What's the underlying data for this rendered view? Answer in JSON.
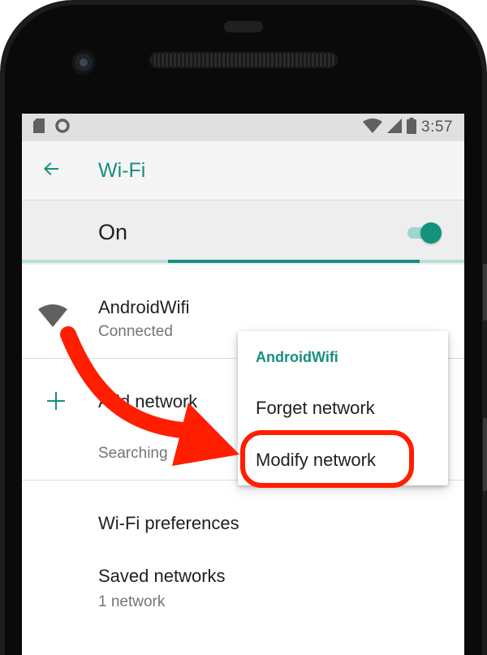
{
  "status_bar": {
    "time": "3:57"
  },
  "toolbar": {
    "title": "Wi-Fi"
  },
  "master_switch": {
    "label": "On",
    "checked": true
  },
  "networks": [
    {
      "ssid": "AndroidWifi",
      "status": "Connected"
    }
  ],
  "add_network": {
    "label": "Add network",
    "sub": "Searching"
  },
  "preferences": [
    {
      "title": "Wi-Fi preferences",
      "sub": ""
    },
    {
      "title": "Saved networks",
      "sub": "1 network"
    }
  ],
  "context_menu": {
    "header": "AndroidWifi",
    "items": [
      "Forget network",
      "Modify network"
    ]
  },
  "colors": {
    "accent": "#178f7f",
    "annotation": "#ff1e00"
  },
  "icons": {
    "back": "arrow-back-icon",
    "wifi": "wifi-signal-icon",
    "add": "plus-icon",
    "sd": "sd-card-icon",
    "circle": "circle-notification-icon",
    "wifi_status": "wifi-status-icon",
    "cell": "cell-signal-icon",
    "battery": "battery-icon"
  }
}
